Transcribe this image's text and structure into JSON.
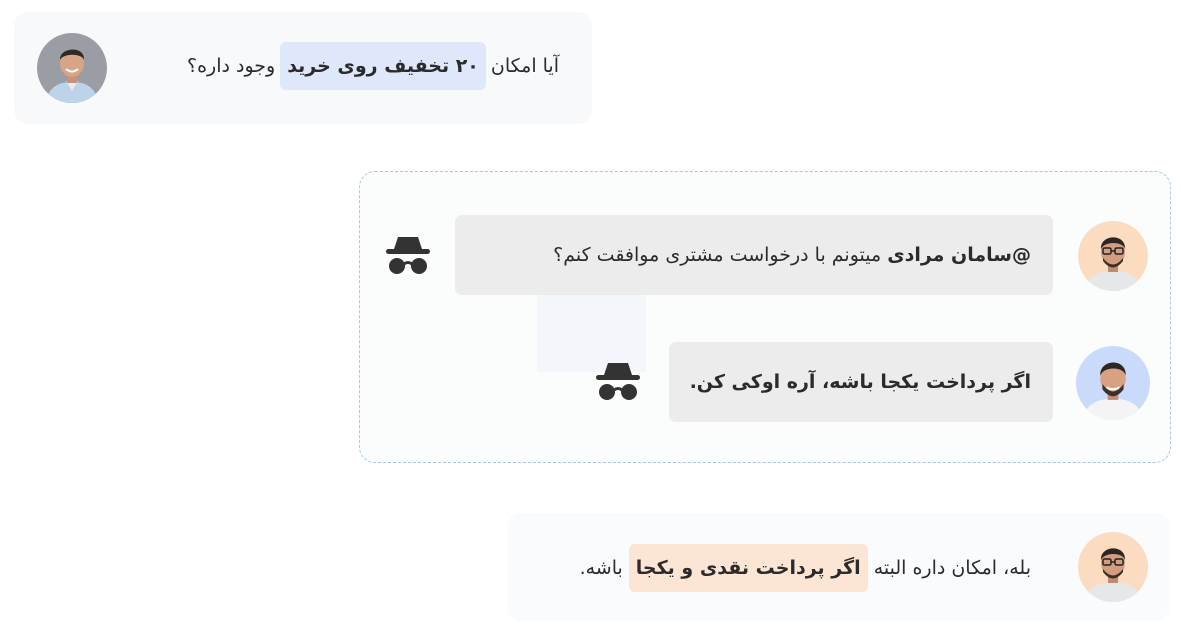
{
  "customer_message": {
    "before": "آیا امکان",
    "highlight": "۲۰ تخفیف روی خرید",
    "after": "وجود داره؟"
  },
  "internal_discussion": {
    "question": {
      "mention": "@سامان مرادی",
      "text": "میتونم با درخواست مشتری موافقت کنم؟"
    },
    "answer": {
      "text": "اگر پرداخت یکجا باشه، آره اوکی کن."
    },
    "private_icon": "incognito-icon"
  },
  "reply_message": {
    "before": "بله، امکان داره البته",
    "highlight": "اگر پرداخت نقدی و یکجا",
    "after": "باشه."
  },
  "colors": {
    "highlight_blue": "#dfe7fb",
    "highlight_orange": "#fde5d5",
    "bubble_gray": "#ececec",
    "dashed_border": "#a9c8e0"
  }
}
